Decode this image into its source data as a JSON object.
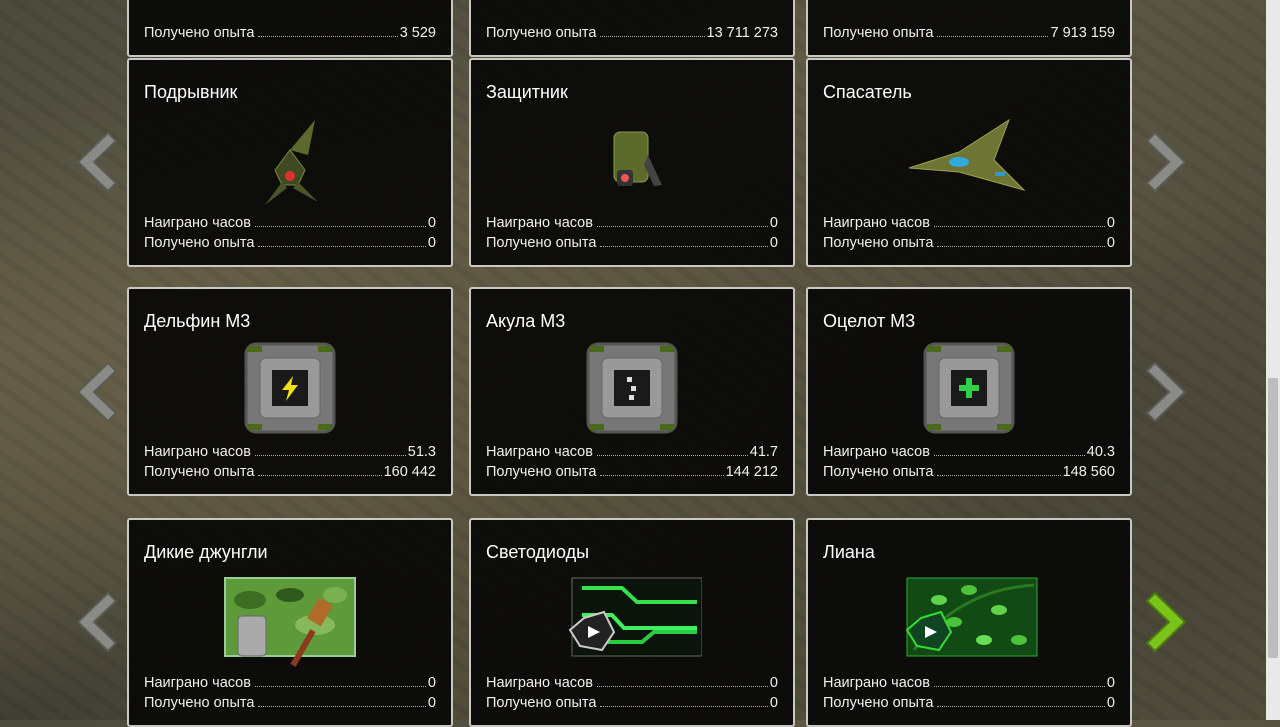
{
  "labels": {
    "hours": "Наиграно часов",
    "exp": "Получено опыта"
  },
  "rows": [
    {
      "cards": [
        {
          "title": "",
          "hours": "",
          "exp": "3 529"
        },
        {
          "title": "",
          "hours": "",
          "exp": "13 711 273"
        },
        {
          "title": "",
          "hours": "",
          "exp": "7 913 159"
        }
      ]
    },
    {
      "cards": [
        {
          "title": "Подрывник",
          "hours": "0",
          "exp": "0",
          "icon": "drone-bomber-icon"
        },
        {
          "title": "Защитник",
          "hours": "0",
          "exp": "0",
          "icon": "drone-defender-icon"
        },
        {
          "title": "Спасатель",
          "hours": "0",
          "exp": "0",
          "icon": "drone-rescuer-icon"
        }
      ]
    },
    {
      "cards": [
        {
          "title": "Дельфин М3",
          "hours": "51.3",
          "exp": "160 442",
          "icon": "module-lightning-icon"
        },
        {
          "title": "Акула М3",
          "hours": "41.7",
          "exp": "144 212",
          "icon": "module-dots-icon"
        },
        {
          "title": "Оцелот М3",
          "hours": "40.3",
          "exp": "148 560",
          "icon": "module-plus-icon"
        }
      ]
    },
    {
      "cards": [
        {
          "title": "Дикие джунгли",
          "hours": "0",
          "exp": "0",
          "icon": "paint-jungle-icon"
        },
        {
          "title": "Светодиоды",
          "hours": "0",
          "exp": "0",
          "icon": "paint-led-icon"
        },
        {
          "title": "Лиана",
          "hours": "0",
          "exp": "0",
          "icon": "paint-liana-icon"
        }
      ]
    }
  ],
  "colors": {
    "arrow_active": "#7bc21b",
    "arrow_inactive": "#8a8a86",
    "card_border": "#c9c9c3"
  }
}
